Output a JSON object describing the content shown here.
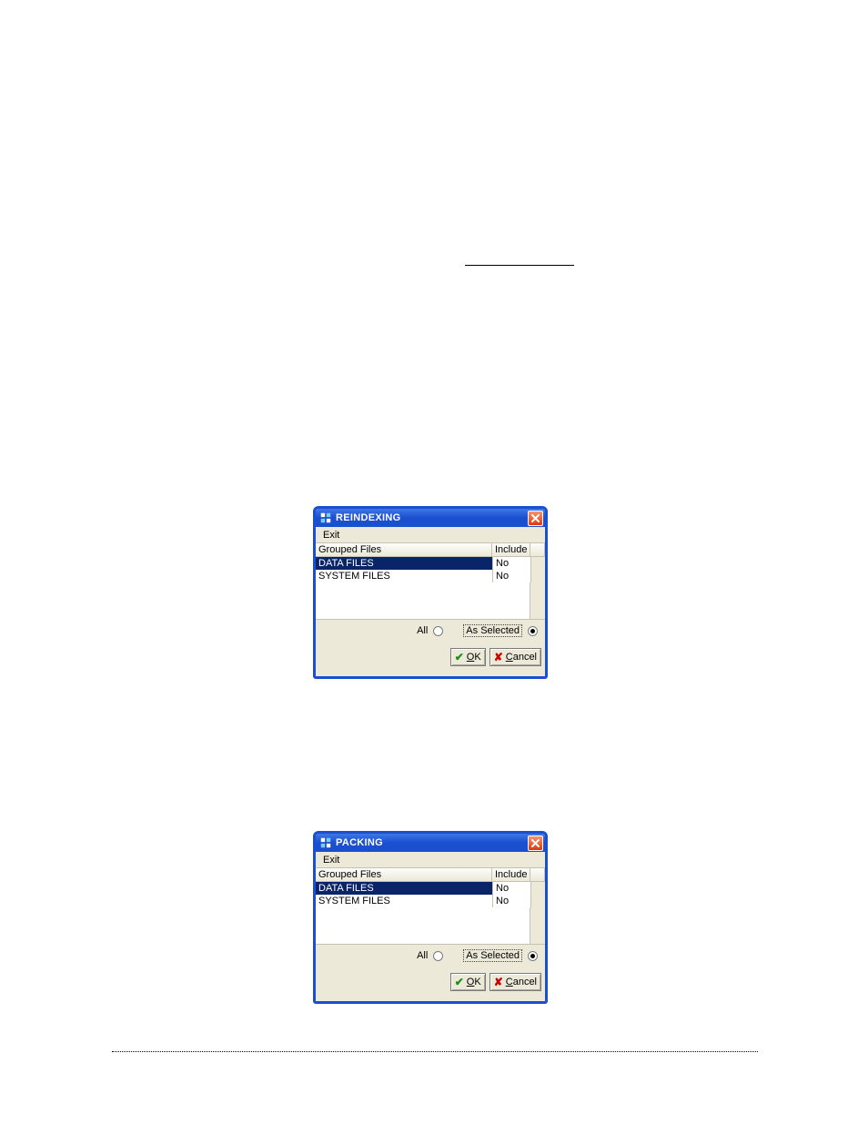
{
  "reindexing": {
    "title": "REINDEXING",
    "menu": {
      "exit": "Exit"
    },
    "table": {
      "header_files": "Grouped Files",
      "header_include": "Include",
      "rows": [
        {
          "files": "DATA FILES",
          "include": "No"
        },
        {
          "files": "SYSTEM FILES",
          "include": "No"
        }
      ]
    },
    "radios": {
      "all": "All",
      "as_selected": "As Selected"
    },
    "buttons": {
      "ok": "OK",
      "cancel": "Cancel"
    }
  },
  "packing": {
    "title": "PACKING",
    "menu": {
      "exit": "Exit"
    },
    "table": {
      "header_files": "Grouped Files",
      "header_include": "Include",
      "rows": [
        {
          "files": "DATA FILES",
          "include": "No"
        },
        {
          "files": "SYSTEM FILES",
          "include": "No"
        }
      ]
    },
    "radios": {
      "all": "All",
      "as_selected": "As Selected"
    },
    "buttons": {
      "ok": "OK",
      "cancel": "Cancel"
    }
  }
}
